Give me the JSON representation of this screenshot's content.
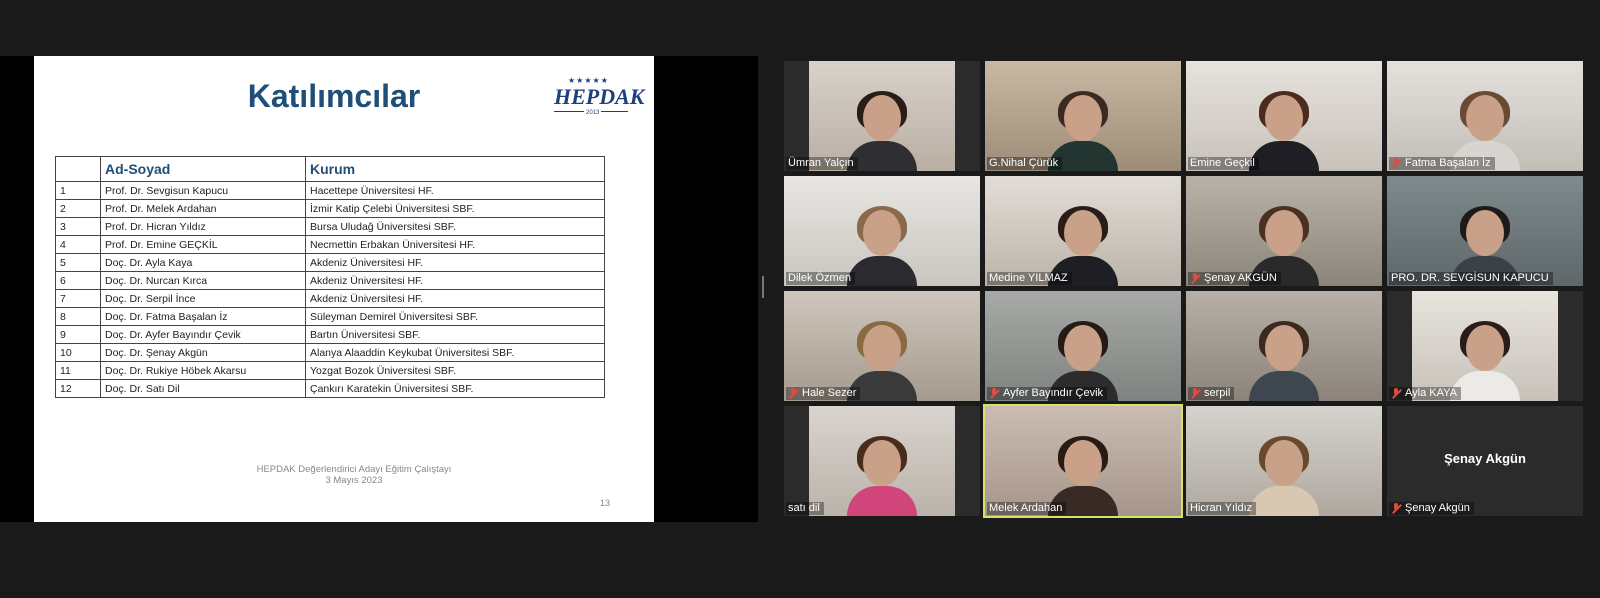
{
  "slide": {
    "title": "Katılımcılar",
    "logo": {
      "text": "HEPDAK",
      "stars": "★★★★★",
      "year": "2013"
    },
    "table": {
      "headers": [
        "",
        "Ad-Soyad",
        "Kurum"
      ],
      "rows": [
        [
          "1",
          "Prof. Dr. Sevgisun Kapucu",
          "Hacettepe Üniversitesi HF."
        ],
        [
          "2",
          "Prof. Dr. Melek Ardahan",
          "İzmir Katip Çelebi Üniversitesi SBF."
        ],
        [
          "3",
          "Prof. Dr. Hicran Yıldız",
          "Bursa Uludağ Üniversitesi SBF."
        ],
        [
          "4",
          "Prof. Dr. Emine GEÇKİL",
          "Necmettin Erbakan Üniversitesi HF."
        ],
        [
          "5",
          "Doç. Dr. Ayla Kaya",
          "Akdeniz Üniversitesi HF."
        ],
        [
          "6",
          "Doç. Dr. Nurcan Kırca",
          "Akdeniz Üniversitesi HF."
        ],
        [
          "7",
          "Doç. Dr. Serpil İnce",
          "Akdeniz Üniversitesi HF."
        ],
        [
          "8",
          "Doç. Dr. Fatma Başalan İz",
          "Süleyman Demirel Üniversitesi SBF."
        ],
        [
          "9",
          "Doç. Dr. Ayfer Bayındır Çevik",
          "Bartın Üniversitesi SBF."
        ],
        [
          "10",
          "Doç. Dr. Şenay Akgün",
          "Alanya Alaaddin Keykubat Üniversitesi SBF."
        ],
        [
          "11",
          "Doç. Dr. Rukiye Höbek Akarsu",
          "Yozgat Bozok Üniversitesi SBF."
        ],
        [
          "12",
          "Doç. Dr. Satı Dil",
          "Çankırı Karatekin Üniversitesi SBF."
        ]
      ]
    },
    "footer_line1": "HEPDAK Değerlendirici Adayı Eğitim Çalıştayı",
    "footer_line2": "3 Mayıs 2023",
    "page_number": "13"
  },
  "participants": [
    {
      "name": "Ümran Yalçın",
      "muted": false,
      "hair": "#2a1d18",
      "shirt": "#2e2e33",
      "bg1": "#d8d2cb",
      "bg2": "#b9aea3"
    },
    {
      "name": "G.Nihal Çürük",
      "muted": false,
      "hair": "#3a2a22",
      "shirt": "#223530",
      "bg1": "#c9b8a4",
      "bg2": "#9d8c78"
    },
    {
      "name": "Emine Geçkil",
      "muted": false,
      "hair": "#4a2b1e",
      "shirt": "#1e1e24",
      "bg1": "#e6e2dc",
      "bg2": "#c8c2ba"
    },
    {
      "name": "Fatma Başalan İz",
      "muted": true,
      "hair": "#6b4a35",
      "shirt": "#d9d4cf",
      "bg1": "#e4e1dd",
      "bg2": "#c2bdb7"
    },
    {
      "name": "Dilek Özmen",
      "muted": false,
      "hair": "#8a6a4a",
      "shirt": "#2a2a30",
      "bg1": "#e8e6e2",
      "bg2": "#c9c6c0"
    },
    {
      "name": "Medine YILMAZ",
      "muted": false,
      "hair": "#2a1c16",
      "shirt": "#1e1f24",
      "bg1": "#e2ddd7",
      "bg2": "#bcb4aa"
    },
    {
      "name": "Şenay AKGÜN",
      "muted": true,
      "hair": "#4b3021",
      "shirt": "#2a2a2a",
      "bg1": "#b8b2a8",
      "bg2": "#8c857a"
    },
    {
      "name": "PRO. DR. SEVGİSUN KAPUCU",
      "muted": false,
      "hair": "#1e1a18",
      "shirt": "#3a4248",
      "bg1": "#7f8a8c",
      "bg2": "#5e6769"
    },
    {
      "name": "Hale Sezer",
      "muted": true,
      "hair": "#8a6a40",
      "shirt": "#3a3a3a",
      "bg1": "#cfc6bd",
      "bg2": "#a49a8e"
    },
    {
      "name": "Ayfer Bayındır Çevik",
      "muted": true,
      "hair": "#241a16",
      "shirt": "#2c2c2c",
      "bg1": "#a7aaa6",
      "bg2": "#7f8380"
    },
    {
      "name": "serpil",
      "muted": true,
      "hair": "#3a2a20",
      "shirt": "#3e4650",
      "bg1": "#b7b0a6",
      "bg2": "#8c847a"
    },
    {
      "name": "Ayla KAYA",
      "muted": true,
      "hair": "#2a1d18",
      "shirt": "#eceae6",
      "bg1": "#e8e4de",
      "bg2": "#c7c1b9"
    },
    {
      "name": "satı dil",
      "muted": false,
      "hair": "#4a2c1c",
      "shirt": "#d0457a",
      "bg1": "#d9d4cf",
      "bg2": "#bab3aa"
    },
    {
      "name": "Melek Ardahan",
      "muted": false,
      "hair": "#2a1a14",
      "shirt": "#3a2a26",
      "bg1": "#cbbcb3",
      "bg2": "#a6958b"
    },
    {
      "name": "Hicran Yıldız",
      "muted": false,
      "hair": "#6a4a2c",
      "shirt": "#d8c8b2",
      "bg1": "#d6d2cd",
      "bg2": "#aea8a0"
    },
    {
      "name": "Şenay Akgün",
      "muted": true,
      "video_off": true,
      "display_name": "Şenay Akgün"
    }
  ]
}
